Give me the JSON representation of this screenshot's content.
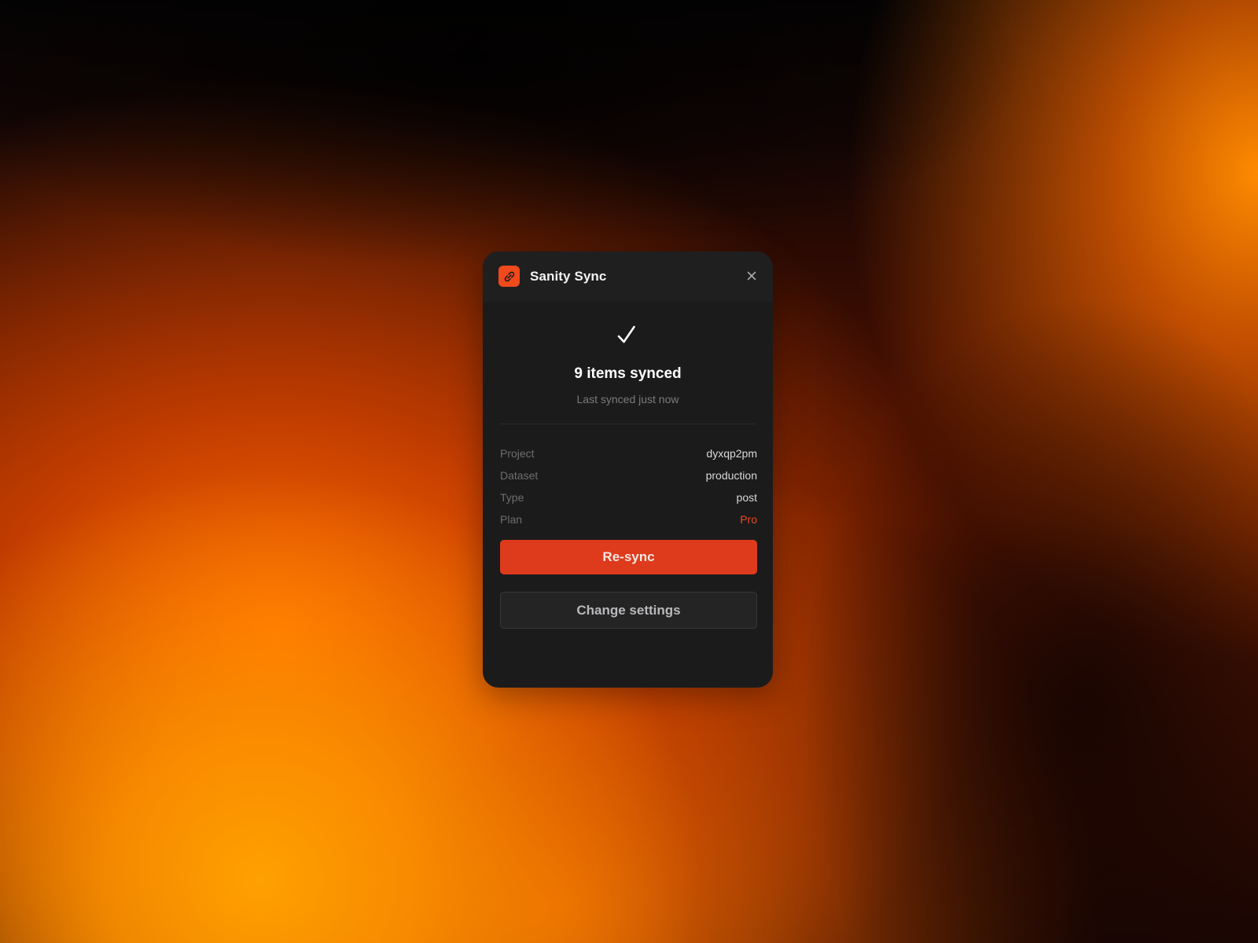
{
  "app": {
    "title": "Sanity Sync",
    "logo_icon": "sanity-link-icon",
    "close_icon": "close-icon",
    "brand_color": "#f04a1c"
  },
  "status": {
    "icon": "check-icon",
    "title": "9 items synced",
    "subtitle": "Last synced just now"
  },
  "details": [
    {
      "label": "Project",
      "value": "dyxqp2pm"
    },
    {
      "label": "Dataset",
      "value": "production"
    },
    {
      "label": "Type",
      "value": "post"
    },
    {
      "label": "Plan",
      "value": "Pro"
    }
  ],
  "actions": {
    "primary_label": "Re-sync",
    "secondary_label": "Change settings"
  }
}
